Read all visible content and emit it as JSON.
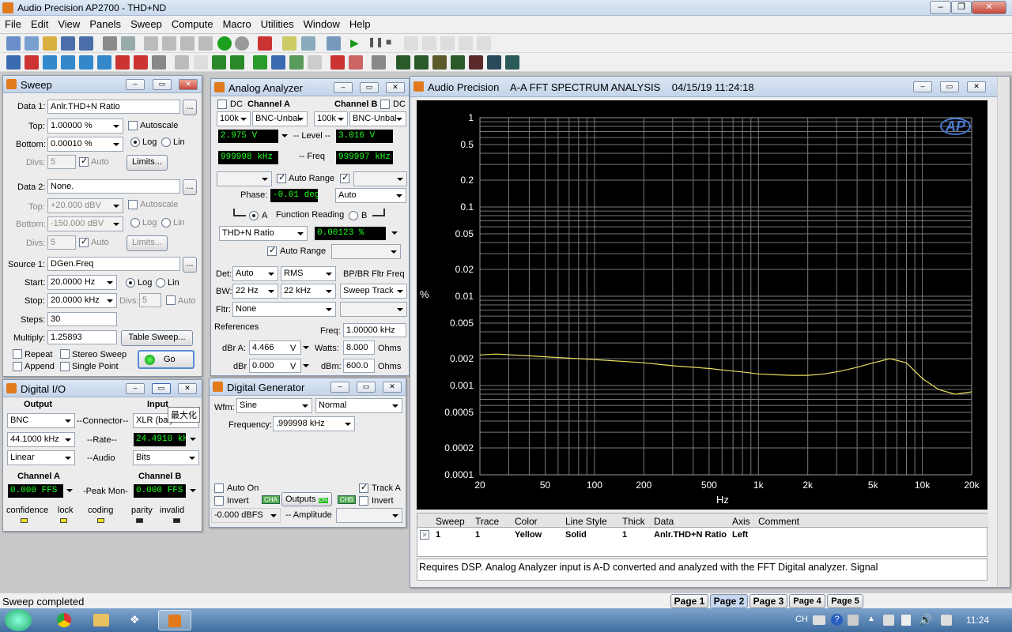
{
  "app": {
    "title": "Audio Precision AP2700 - THD+ND"
  },
  "menu": [
    "File",
    "Edit",
    "View",
    "Panels",
    "Sweep",
    "Compute",
    "Macro",
    "Utilities",
    "Window",
    "Help"
  ],
  "sweep": {
    "title": "Sweep",
    "data1_label": "Data 1:",
    "data1_value": "Anlr.THD+N Ratio",
    "top_label": "Top:",
    "top_value": "1.00000  %",
    "bottom_label": "Bottom:",
    "bottom_value": "0.00010  %",
    "autoscale_label": "Autoscale",
    "log_label": "Log",
    "lin_label": "Lin",
    "divs_label": "Divs:",
    "divs_value": "5",
    "auto_label": "Auto",
    "limits_label": "Limits...",
    "data2_label": "Data 2:",
    "data2_value": "None.",
    "top2_value": "+20.000  dBV",
    "bottom2_value": "-150.000 dBV",
    "divs2_value": "5",
    "source1_label": "Source 1:",
    "source1_value": "DGen.Freq",
    "start_label": "Start:",
    "start_value": "20.0000  Hz",
    "stop_label": "Stop:",
    "stop_value": "20.0000 kHz",
    "divs3_value": "5",
    "steps_label": "Steps:",
    "steps_value": "30",
    "multiply_label": "Multiply:",
    "multiply_value": "1.25893",
    "table_sweep_label": "Table Sweep...",
    "repeat_label": "Repeat",
    "stereo_label": "Stereo Sweep",
    "append_label": "Append",
    "single_label": "Single Point",
    "go_label": "Go",
    "ellipsis": "..."
  },
  "analyzer": {
    "title": "Analog Analyzer",
    "dc": "DC",
    "cha_label": "Channel A",
    "chb_label": "Channel B",
    "range_a": "100k",
    "conn_a": "BNC-Unbal",
    "range_b": "100k",
    "conn_b": "BNC-Unbal",
    "level_a": "2.975   V",
    "level_label": "-- Level --",
    "level_b": "3.016   V",
    "freq_a": "999998 kHz",
    "freq_label": "-- Freq",
    "freq_b": "999997 kHz",
    "auto_range": "Auto Range",
    "phase_label": "Phase:",
    "phase_value": "-0.01   deg",
    "phase_mode": "Auto",
    "a": "A",
    "function_reading": "Function Reading",
    "b": "B",
    "function": "THD+N Ratio",
    "function_value": "0.00123  %",
    "det_label": "Det:",
    "det": "Auto",
    "det_type": "RMS",
    "bpbr": "BP/BR Fltr Freq",
    "bw_label": "BW:",
    "bw_low": "22 Hz",
    "bw_high": "22 kHz",
    "bw_track": "Sweep Track",
    "fltr_label": "Fltr:",
    "fltr": "None",
    "references": "References",
    "freq_ref_label": "Freq:",
    "freq_ref": "1.00000 kHz",
    "dbra_label": "dBr A:",
    "dbra": "4.466",
    "unit_v": "V",
    "watts_label": "Watts:",
    "watts": "8.000",
    "ohms": "Ohms",
    "dbr_label": "dBr",
    "dbr": "0.000",
    "dbm_label": "dBm:",
    "dbm": "600.0"
  },
  "digital_io": {
    "title": "Digital I/O",
    "output": "Output",
    "input": "Input",
    "out_connector": "BNC",
    "connector_label": "--Connector--",
    "in_connector": "XLR (bal)",
    "tooltip": "最大化",
    "out_rate": "44.1000 kHz",
    "rate_label": "--Rate--",
    "in_rate": "24.4910 kHz",
    "out_audio": "Linear",
    "audio_label": "--Audio",
    "in_audio": "Bits",
    "cha": "Channel A",
    "chb": "Channel B",
    "peak_label": "-Peak Mon-",
    "peak_a": "0.000    FFS",
    "peak_b": "0.000    FFS",
    "status": [
      "confidence",
      "lock",
      "coding",
      "parity",
      "invalid"
    ]
  },
  "generator": {
    "title": "Digital Generator",
    "wfm_label": "Wfm:",
    "wfm": "Sine",
    "wfm_mode": "Normal",
    "freq_label": "Frequency:",
    "freq": ".999998 kHz",
    "auto_on": "Auto On",
    "invert": "Invert",
    "outputs": "Outputs",
    "on": "ON",
    "cha_badge": "CHA",
    "chb_badge": "CHB",
    "track_a": "Track A",
    "invert_b": "Invert",
    "amplitude": "-0.000   dBFS",
    "amplitude_label": "-- Amplitude"
  },
  "graph": {
    "title": "Audio Precision    A-A FFT SPECTRUM ANALYSIS    04/15/19 11:24:18",
    "logo": "AP",
    "yunit": "%",
    "xunit": "Hz",
    "table_headers": [
      "Sweep",
      "Trace",
      "Color",
      "Line Style",
      "Thick",
      "Data",
      "Axis",
      "Comment"
    ],
    "table_row": [
      "1",
      "1",
      "Yellow",
      "Solid",
      "1",
      "Anlr.THD+N Ratio",
      "Left",
      ""
    ],
    "comment": "Requires DSP.  Analog Analyzer input is A-D converted and analyzed with the FFT Digital analyzer.  Signal"
  },
  "status_bar": {
    "text": "Sweep completed",
    "pages": [
      "Page 1",
      "Page 2",
      "Page 3",
      "Page 4",
      "Page 5"
    ]
  },
  "taskbar": {
    "time": "11:24",
    "lang": "CH"
  },
  "colors": {
    "trace": "#e8e060",
    "plot_bg": "#000000",
    "accent": "#e07a1c"
  },
  "chart_data": {
    "type": "line",
    "title": "",
    "xlabel": "Hz",
    "ylabel": "%",
    "xscale": "log",
    "yscale": "log",
    "xlim": [
      20,
      20000
    ],
    "ylim": [
      0.0001,
      1
    ],
    "x_ticks": [
      "20",
      "50",
      "100",
      "200",
      "500",
      "1k",
      "2k",
      "5k",
      "10k",
      "20k"
    ],
    "y_ticks": [
      "1",
      "0.5",
      "0.2",
      "0.1",
      "0.05",
      "0.02",
      "0.01",
      "0.005",
      "0.002",
      "0.001",
      "0.0005",
      "0.0002",
      "0.0001"
    ],
    "series": [
      {
        "x": [
          20,
          25,
          32,
          40,
          50,
          63,
          80,
          100,
          126,
          159,
          200,
          252,
          317,
          400,
          504,
          634,
          798,
          1000,
          1260,
          1590,
          2000,
          2520,
          3170,
          4000,
          5040,
          6340,
          7980,
          10000,
          12600,
          15900,
          20000
        ],
        "values": [
          0.0022,
          0.00225,
          0.0022,
          0.00215,
          0.0021,
          0.00205,
          0.002,
          0.00195,
          0.0019,
          0.00185,
          0.0018,
          0.00172,
          0.00165,
          0.0016,
          0.00155,
          0.00148,
          0.00142,
          0.00135,
          0.00132,
          0.0013,
          0.0013,
          0.00135,
          0.00145,
          0.0016,
          0.0018,
          0.002,
          0.0018,
          0.0012,
          0.0009,
          0.0008,
          0.00085
        ]
      }
    ]
  }
}
